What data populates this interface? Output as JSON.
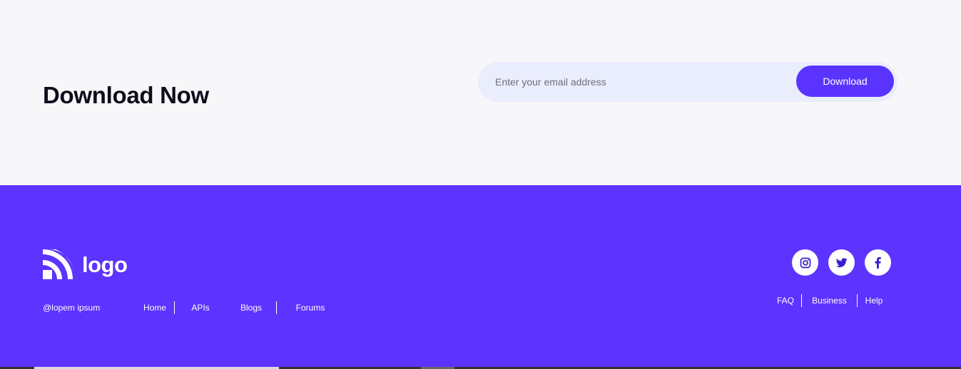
{
  "cta": {
    "title": "Download Now",
    "email_placeholder": "Enter your email address",
    "download_label": "Download"
  },
  "footer": {
    "logo_text": "logo",
    "copyright": "@lopem ipsum",
    "left_links": [
      "Home",
      "APIs",
      "Blogs",
      "Forums"
    ],
    "socials": [
      "instagram-icon",
      "twitter-icon",
      "facebook-icon"
    ],
    "right_links": [
      "FAQ",
      "Business",
      "Help"
    ]
  },
  "colors": {
    "brand": "#5c33ff",
    "button": "#5a33ff",
    "input_bg": "#eaedfe",
    "page_bg": "#f7f7fa"
  }
}
